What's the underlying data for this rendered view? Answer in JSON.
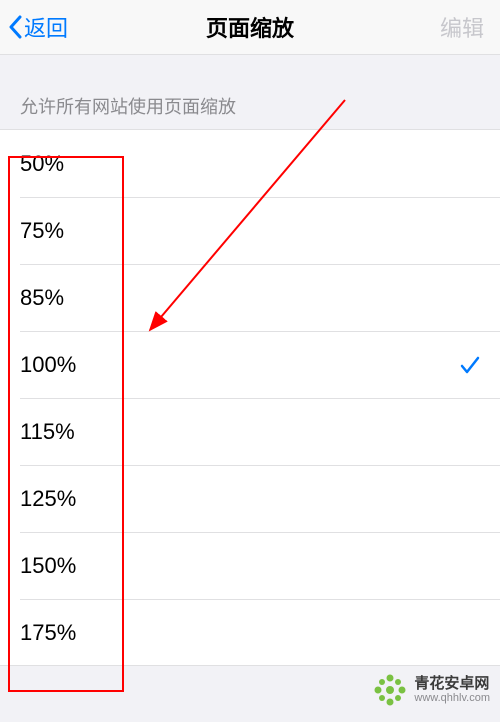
{
  "nav": {
    "back_label": "返回",
    "title": "页面缩放",
    "edit_label": "编辑"
  },
  "section": {
    "header": "允许所有网站使用页面缩放"
  },
  "zoom_options": [
    {
      "label": "50%",
      "selected": false
    },
    {
      "label": "75%",
      "selected": false
    },
    {
      "label": "85%",
      "selected": false
    },
    {
      "label": "100%",
      "selected": true
    },
    {
      "label": "115%",
      "selected": false
    },
    {
      "label": "125%",
      "selected": false
    },
    {
      "label": "150%",
      "selected": false
    },
    {
      "label": "175%",
      "selected": false
    }
  ],
  "colors": {
    "accent": "#007aff",
    "disabled": "#c7c7cc",
    "highlight": "#ff0000",
    "wm_green": "#7ac142"
  },
  "watermark": {
    "brand": "青花安卓网",
    "url": "www.qhhlv.com"
  }
}
